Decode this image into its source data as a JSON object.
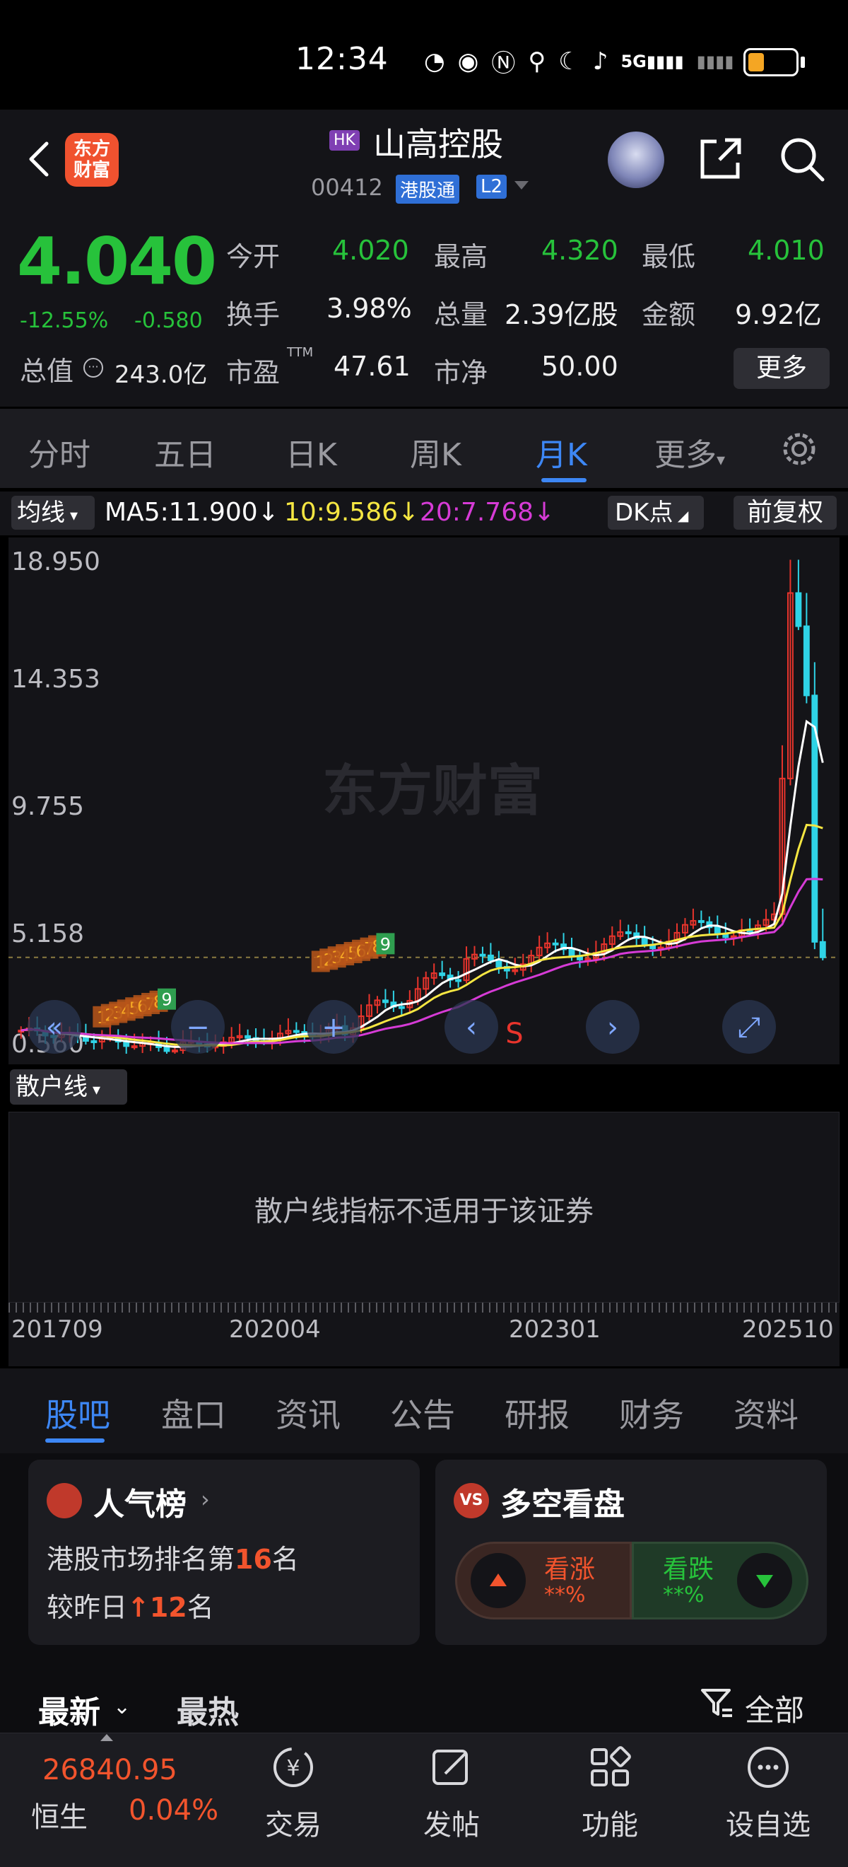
{
  "status": {
    "time": "12:34",
    "net": "5G"
  },
  "header": {
    "app_logo": "东方\n财富",
    "market_tag": "HK",
    "stock_name": "山高控股",
    "stock_code": "00412",
    "connect_tag": "港股通",
    "level_tag": "L2"
  },
  "quote": {
    "price": "4.040",
    "pct": "-12.55%",
    "chg": "-0.580",
    "open_label": "今开",
    "open": "4.020",
    "high_label": "最高",
    "high": "4.320",
    "low_label": "最低",
    "low": "4.010",
    "turnover_label": "换手",
    "turnover": "3.98%",
    "volume_label": "总量",
    "volume": "2.39亿股",
    "amount_label": "金额",
    "amount": "9.92亿",
    "mv_label": "总值",
    "mv": "243.0亿",
    "pe_label": "市盈",
    "pe_sup": "TTM",
    "pe": "47.61",
    "pb_label": "市净",
    "pb": "50.00",
    "more": "更多"
  },
  "period_tabs": [
    "分时",
    "五日",
    "日K",
    "周K",
    "月K",
    "更多"
  ],
  "active_period": "月K",
  "ma_row": {
    "select": "均线",
    "ma5": "MA5:11.900↓",
    "ma10": "10:9.586↓",
    "ma20": "20:7.768↓",
    "dk": "DK点",
    "adjust": "前复权"
  },
  "colors": {
    "up": "#f2542d",
    "down": "#27c23b",
    "accent": "#3d87f5",
    "candle_up": "#e8342c",
    "candle_down": "#2fd3e6",
    "ma5": "#ffffff",
    "ma10": "#f5e642",
    "ma20": "#d63bd6"
  },
  "chart_data": {
    "type": "candlestick",
    "y_ticks": [
      "18.950",
      "14.353",
      "9.755",
      "5.158",
      "0.560"
    ],
    "ylim": [
      0.56,
      18.95
    ],
    "watermark": "东方财富",
    "signal_buy_label": "S",
    "seq_labels_1": [
      "1",
      "2",
      "3",
      "4",
      "5",
      "6",
      "7",
      "8",
      "9"
    ],
    "seq_labels_2": [
      "1",
      "2",
      "3",
      "4",
      "5",
      "6",
      "7",
      "8",
      "9"
    ],
    "x_labels": [
      "201709",
      "202004",
      "202301",
      "202510"
    ],
    "ma5_last": 11.9,
    "ma10_last": 9.586,
    "ma20_last": 7.768,
    "last_price": 4.04
  },
  "indicator": {
    "select": "散户线",
    "message": "散户线指标不适用于该证券"
  },
  "section_tabs": [
    "股吧",
    "盘口",
    "资讯",
    "公告",
    "研报",
    "财务",
    "资料"
  ],
  "popularity": {
    "title": "人气榜",
    "line1_prefix": "港股市场排名第",
    "rank": "16",
    "line1_suffix": "名",
    "line2_prefix": "较昨日",
    "change": "12",
    "line2_suffix": "名"
  },
  "sentiment": {
    "title": "多空看盘",
    "vs": "VS",
    "bull_label": "看涨",
    "bull_value": "**%",
    "bear_label": "看跌",
    "bear_value": "**%"
  },
  "feed_sort": {
    "latest": "最新",
    "hot": "最热",
    "filter": "全部"
  },
  "bottom_nav": {
    "index_value": "26840.95",
    "index_name": "恒生",
    "index_pct": "0.04%",
    "items": [
      "交易",
      "发帖",
      "功能",
      "设自选"
    ]
  }
}
